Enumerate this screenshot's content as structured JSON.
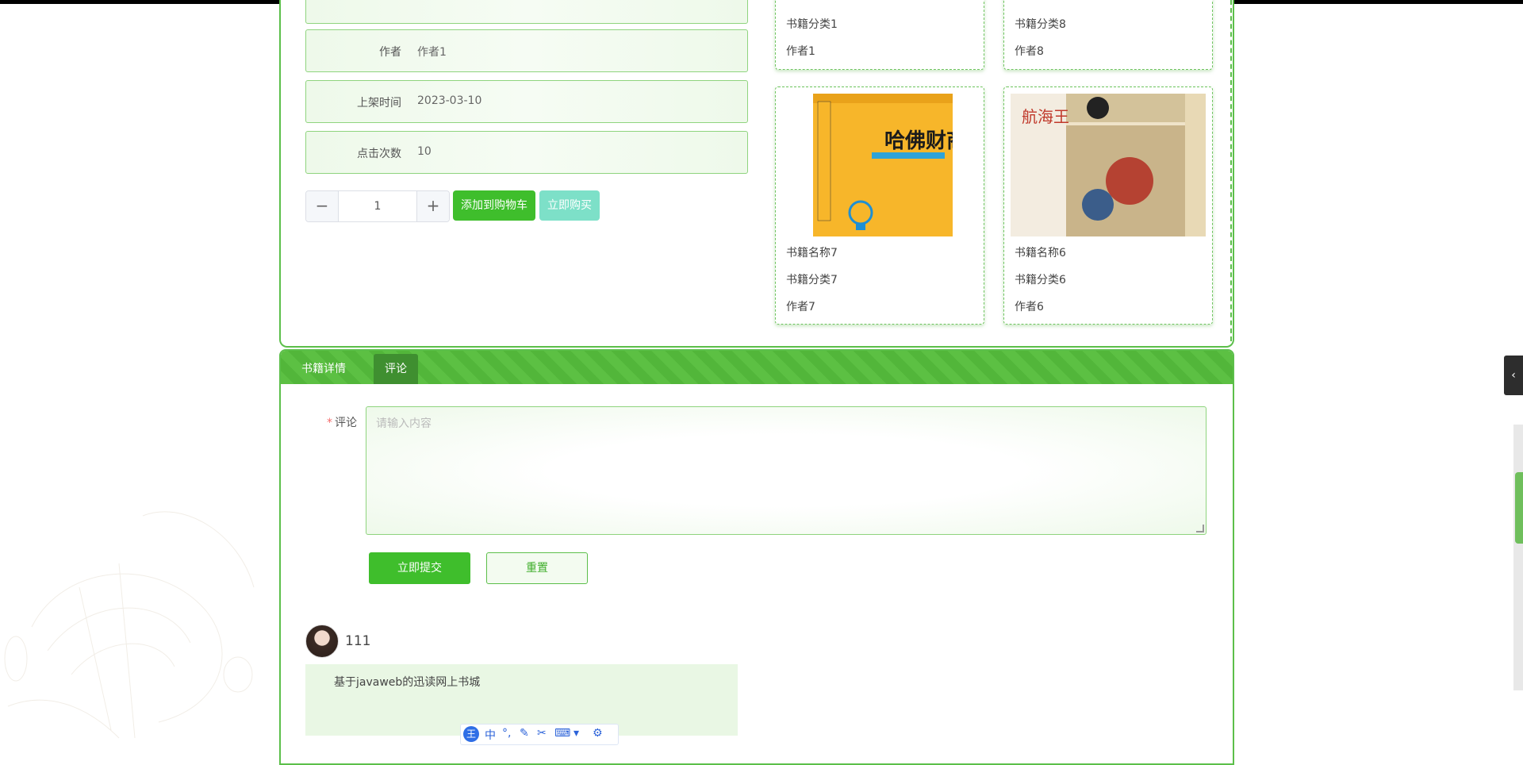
{
  "book_info": {
    "author_label": "作者",
    "author_value": "作者1",
    "date_label": "上架时间",
    "date_value": "2023-03-10",
    "clicks_label": "点击次数",
    "clicks_value": "10"
  },
  "purchase": {
    "minus": "−",
    "plus": "+",
    "quantity": "1",
    "add_to_cart": "添加到购物车",
    "buy_now": "立即购买"
  },
  "recommend": [
    {
      "category": "书籍分类1",
      "author": "作者1"
    },
    {
      "category": "书籍分类8",
      "author": "作者8"
    },
    {
      "name": "书籍名称7",
      "category": "书籍分类7",
      "author": "作者7",
      "cover_title": "哈佛财商课"
    },
    {
      "name": "书籍名称6",
      "category": "书籍分类6",
      "author": "作者6",
      "cover_title": "航海王"
    }
  ],
  "tabs": [
    {
      "label": "书籍详情"
    },
    {
      "label": "评论"
    }
  ],
  "comment_form": {
    "label": "评论",
    "placeholder": "请输入内容",
    "submit": "立即提交",
    "reset": "重置"
  },
  "comments": [
    {
      "user": "111",
      "content": "基于javaweb的迅读网上书城"
    }
  ],
  "side_handle": "‹",
  "ime": {
    "logo": "王",
    "mode": "中"
  },
  "colors": {
    "primary": "#3fbe2c",
    "border": "#5cbf4a",
    "light": "#eef9ea"
  }
}
